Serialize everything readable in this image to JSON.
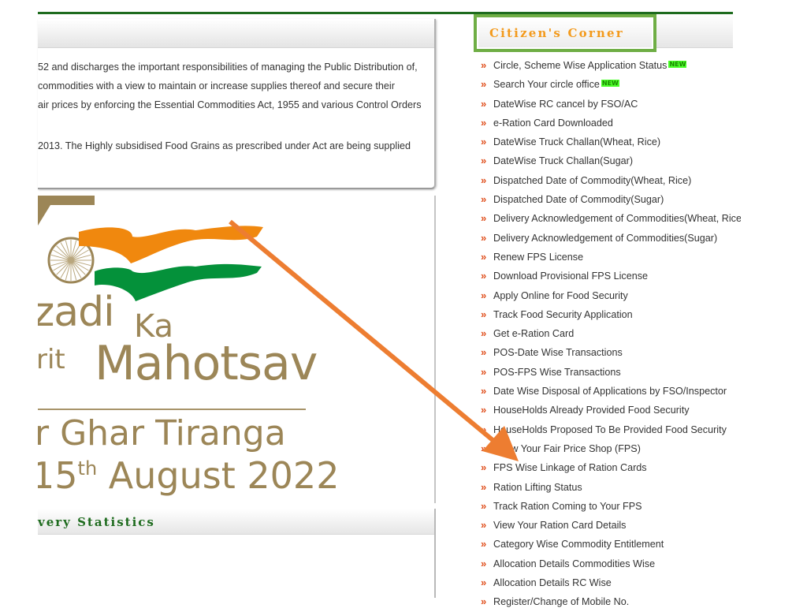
{
  "about": {
    "lines": [
      "52 and discharges the important responsibilities of managing the Public Distribution of,",
      " commodities with a view to maintain or increase supplies thereof and secure their",
      "air prices by enforcing the Essential Commodities Act, 1955 and various Control Orders",
      "2013. The Highly subsidised Food Grains as prescribed under Act are being supplied"
    ]
  },
  "banner": {
    "line_zadi": "zadi",
    "line_ka": "Ka",
    "line_rit": "rit",
    "line_mahotsav": "Mahotsav",
    "line_ghar": "r Ghar Tiranga",
    "line_day": "15",
    "line_day_suffix": "th",
    "line_month_year": " August 2022",
    "colors": {
      "saffron": "#f0880e",
      "green": "#04913a",
      "gold": "#9c8657"
    }
  },
  "stats": {
    "title": "very Statistics"
  },
  "citizen_corner": {
    "title": "Citizen's Corner",
    "bullet": "»",
    "new_label": "NEW",
    "items": [
      {
        "label": "Circle, Scheme Wise Application Status",
        "is_new": true
      },
      {
        "label": "Search Your circle office",
        "is_new": true
      },
      {
        "label": "DateWise RC cancel by FSO/AC"
      },
      {
        "label": "e-Ration Card Downloaded"
      },
      {
        "label": "DateWise Truck Challan(Wheat, Rice)"
      },
      {
        "label": "DateWise Truck Challan(Sugar)"
      },
      {
        "label": "Dispatched Date of Commodity(Wheat, Rice)"
      },
      {
        "label": "Dispatched Date of Commodity(Sugar)"
      },
      {
        "label": "Delivery Acknowledgement of Commodities(Wheat, Rice)"
      },
      {
        "label": "Delivery Acknowledgement of Commodities(Sugar)"
      },
      {
        "label": "Renew FPS License"
      },
      {
        "label": "Download Provisional FPS License"
      },
      {
        "label": "Apply Online for Food Security"
      },
      {
        "label": "Track Food Security Application"
      },
      {
        "label": "Get e-Ration Card"
      },
      {
        "label": "POS-Date Wise Transactions"
      },
      {
        "label": "POS-FPS Wise Transactions"
      },
      {
        "label": "Date Wise Disposal of Applications by FSO/Inspector"
      },
      {
        "label": "HouseHolds Already Provided Food Security"
      },
      {
        "label": "HouseHolds Proposed To Be Provided Food Security"
      },
      {
        "label": "Know Your Fair Price Shop (FPS)"
      },
      {
        "label": "FPS Wise Linkage of Ration Cards"
      },
      {
        "label": "Ration Lifting Status"
      },
      {
        "label": "Track Ration Coming to Your FPS"
      },
      {
        "label": "View Your Ration Card Details"
      },
      {
        "label": "Category Wise Commodity Entitlement"
      },
      {
        "label": "Allocation Details Commodities Wise"
      },
      {
        "label": "Allocation Details RC Wise"
      },
      {
        "label": "Register/Change of Mobile No."
      }
    ]
  },
  "annotation": {
    "arrow_color": "#ed7d31",
    "points_to": "FPS Wise Linkage of Ration Cards"
  }
}
